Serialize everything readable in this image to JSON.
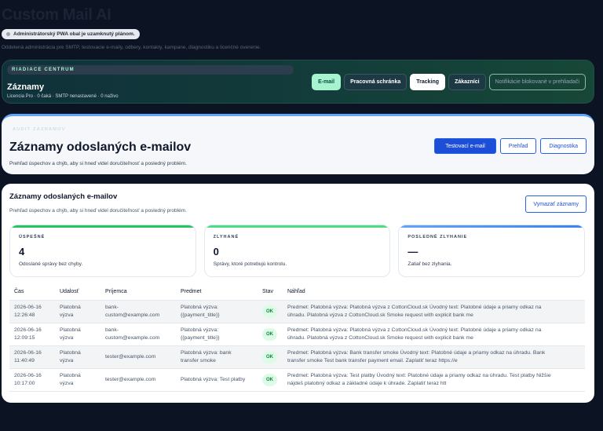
{
  "app": {
    "title": "Custom Mail AI",
    "pwa_badge": "Administrátorský PWA obal je uzamknutý plánom.",
    "subtitle": "Oddelená administrácia pre SMTP, testovacie e-maily, odbery, kontakty, kampane, diagnostiku a licenčné overenie."
  },
  "control_center": {
    "label": "RIADIACE CENTRUM",
    "title": "Záznamy",
    "meta": "Licencia Pro · 0 čaká · SMTP nenastavené · 0 naživo",
    "nav": [
      {
        "label": "E-mail"
      },
      {
        "label": "Pracovná schránka"
      },
      {
        "label": "Tracking"
      },
      {
        "label": "Zákazníci"
      },
      {
        "label": "Notifikácie blokované v prehliadači"
      }
    ]
  },
  "audit": {
    "eyebrow": "AUDIT ZÁZNAMOV",
    "title": "Záznamy odoslaných e-mailov",
    "description": "Prehľad úspechov a chýb, aby si hneď videl doručiteľnosť a posledný problém.",
    "actions": {
      "test_email": "Testovací e-mail",
      "overview": "Prehľad",
      "diagnostics": "Diagnostika"
    }
  },
  "records": {
    "title": "Záznamy odoslaných e-mailov",
    "description": "Prehľad úspechov a chýb, aby si hneď videl doručiteľnosť a posledný problém.",
    "clear_button": "Vymazať záznamy",
    "stats": {
      "success": {
        "label": "ÚSPEŠNÉ",
        "value": "4",
        "note": "Odoslané správy bez chyby."
      },
      "failed": {
        "label": "ZLYHANÉ",
        "value": "0",
        "note": "Správy, ktoré potrebujú kontrolu."
      },
      "last_failure": {
        "label": "POSLEDNÉ ZLYHANIE",
        "value": "—",
        "note": "Zatiaľ bez zlyhania."
      }
    },
    "columns": {
      "time": "Čas",
      "event": "Udalosť",
      "recipient": "Príjemca",
      "subject": "Predmet",
      "status": "Stav",
      "preview": "Náhľad"
    },
    "rows": [
      {
        "date": "2026-06-16",
        "time": "12:26:48",
        "event_1": "Platobná",
        "event_2": "výzva",
        "recipient_1": "bank-",
        "recipient_2": "custom@example.com",
        "subject_1": "Platobná výzva:",
        "subject_2": "{{payment_title}}",
        "status": "OK",
        "preview_1": "Predmet: Platobná výzva: Platobná výzva z CottonCloud.sk Úvodný text: Platobné údaje a priamy odkaz na",
        "preview_2": "úhradu. Platobná výzva z CottonCloud.sk Smoke request with explicit bank me"
      },
      {
        "date": "2026-06-16",
        "time": "12:09:15",
        "event_1": "Platobná",
        "event_2": "výzva",
        "recipient_1": "bank-",
        "recipient_2": "custom@example.com",
        "subject_1": "Platobná výzva:",
        "subject_2": "{{payment_title}}",
        "status": "OK",
        "preview_1": "Predmet: Platobná výzva: Platobná výzva z CottonCloud.sk Úvodný text: Platobné údaje a priamy odkaz na",
        "preview_2": "úhradu. Platobná výzva z CottonCloud.sk Smoke request with explicit bank me"
      },
      {
        "date": "2026-06-16",
        "time": "11:40:49",
        "event_1": "Platobná",
        "event_2": "výzva",
        "recipient_1": "tester@example.com",
        "recipient_2": "",
        "subject_1": "Platobná výzva: bank",
        "subject_2": "transfer smoke",
        "status": "OK",
        "preview_1": "Predmet: Platobná výzva: Bank transfer smoke Úvodný text: Platobné údaje a priamy odkaz na úhradu. Bank",
        "preview_2": "transfer smoke Test bank transfer payment email. Zaplatiť teraz https://e"
      },
      {
        "date": "2026-06-16",
        "time": "10:17:00",
        "event_1": "Platobná",
        "event_2": "výzva",
        "recipient_1": "tester@example.com",
        "recipient_2": "",
        "subject_1": "Platobná výzva: Test platby",
        "subject_2": "",
        "status": "OK",
        "preview_1": "Predmet: Platobná výzva: Test platby Úvodný text: Platobné údaje a priamy odkaz na úhradu. Test platby Nižšie",
        "preview_2": "nájdeš platobný odkaz a základné údaje k úhrade. Zaplatiť teraz htt"
      }
    ]
  }
}
